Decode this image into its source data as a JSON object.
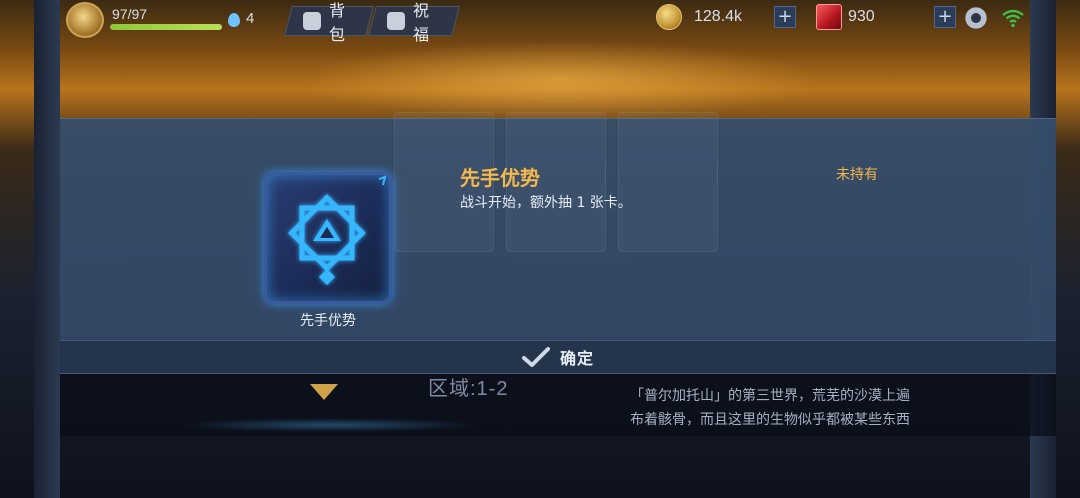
{
  "topbar": {
    "hp_text": "97/97",
    "hp_fraction": 1.0,
    "drops_count": "4",
    "bag_label": "背包",
    "bless_label": "祝福",
    "coins": "128.4k",
    "gems": "930",
    "icons": {
      "avatar": "hero-avatar",
      "drop": "water-drop-icon",
      "bag": "bag-icon",
      "bless": "blessing-icon",
      "coin": "gold-coin-icon",
      "gem": "red-gem-icon",
      "plus": "plus-icon",
      "settings": "gear-icon",
      "wifi": "wifi-icon"
    }
  },
  "modal": {
    "card_label": "先手优势",
    "title": "先手优势",
    "description": "战斗开始，额外抽 1 张卡。",
    "status": "未持有",
    "confirm_label": "确定",
    "accent_color": "#f2b84b",
    "glow_color": "#2fa8ff"
  },
  "background": {
    "area": "区域:1-2",
    "description_line1": "「普尔加托山」的第三世界，荒芜的沙漠上遍",
    "description_line2": "布着骸骨，而且这里的生物似乎都被某些东西"
  }
}
